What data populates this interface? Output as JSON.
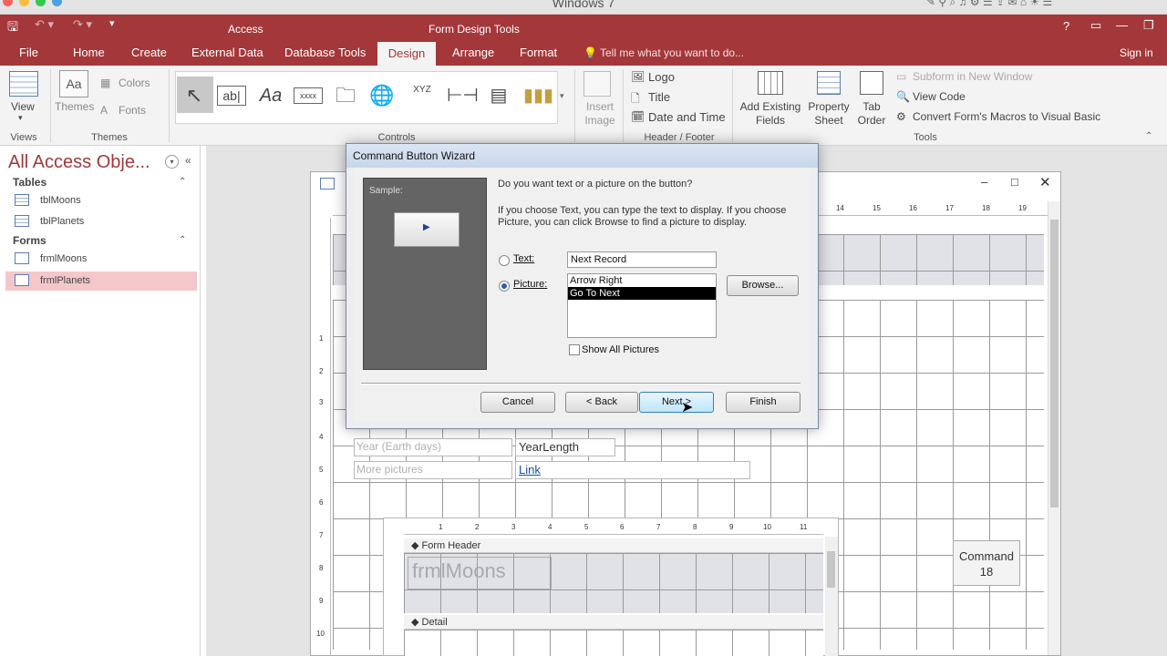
{
  "os_title": "Windows 7",
  "app": {
    "name": "Access",
    "context_tab_group": "Form Design Tools",
    "tabs": [
      "File",
      "Home",
      "Create",
      "External Data",
      "Database Tools",
      "Design",
      "Arrange",
      "Format"
    ],
    "tell_me": "Tell me what you want to do...",
    "sign_in": "Sign in",
    "help": "?"
  },
  "ribbon": {
    "views": {
      "view_label": "View",
      "group": "Views"
    },
    "themes": {
      "themes_label": "Themes",
      "colors_label": "Colors",
      "fonts_label": "Fonts",
      "group": "Themes"
    },
    "controls": {
      "group": "Controls",
      "icons": [
        "select-pointer",
        "textbox",
        "label-aa",
        "button-xxxx",
        "tab-control",
        "hyperlink",
        "web-browser",
        "navigation",
        "line",
        "page-break",
        "chart"
      ]
    },
    "insert_image": "Insert Image",
    "header_footer": {
      "logo": "Logo",
      "title": "Title",
      "date_time": "Date and Time",
      "group": "Header / Footer"
    },
    "tools": {
      "add_existing_fields": "Add Existing Fields",
      "property_sheet": "Property Sheet",
      "tab_order": "Tab Order",
      "subform_new_window": "Subform in New Window",
      "view_code": "View Code",
      "convert_macros": "Convert Form's Macros to Visual Basic",
      "group": "Tools"
    }
  },
  "nav": {
    "title": "All Access Obje...",
    "sections": [
      {
        "label": "Tables",
        "items": [
          "tblMoons",
          "tblPlanets"
        ]
      },
      {
        "label": "Forms",
        "items": [
          "frmlMoons",
          "frmlPlanets"
        ]
      }
    ],
    "selected": "frmlPlanets"
  },
  "form": {
    "ruler_numbers_top": [
      "14",
      "15",
      "16",
      "17",
      "18",
      "19"
    ],
    "ruler_numbers_left": [
      "1",
      "2",
      "3",
      "4",
      "5",
      "6",
      "7",
      "8",
      "9",
      "10"
    ],
    "fields": [
      {
        "label": "Year (Earth days)",
        "control": "YearLength"
      },
      {
        "label": "More pictures",
        "control": "Link"
      }
    ],
    "command_button": "Command 18"
  },
  "subform": {
    "ruler_numbers": [
      "1",
      "2",
      "3",
      "4",
      "5",
      "6",
      "7",
      "8",
      "9",
      "10",
      "11"
    ],
    "header_section": "Form Header",
    "title": "frmlMoons",
    "detail_section": "Detail"
  },
  "dialog": {
    "title": "Command Button Wizard",
    "sample_label": "Sample:",
    "question": "Do you want text or a picture on the button?",
    "explanation": "If you choose Text, you can type the text to display.  If you choose Picture, you can click Browse to find a picture to display.",
    "text_option": "Text:",
    "text_value": "Next Record",
    "picture_option": "Picture:",
    "selected_option": "picture",
    "picture_list": [
      "Arrow Right",
      "Go To Next"
    ],
    "selected_picture": "Go To Next",
    "browse": "Browse...",
    "show_all_pictures": "Show All Pictures",
    "show_all_checked": false,
    "buttons": {
      "cancel": "Cancel",
      "back": "< Back",
      "next": "Next >",
      "finish": "Finish"
    }
  },
  "colors": {
    "accent": "#a4373a",
    "selection": "#f4c7cb",
    "sample_bg": "#646464"
  }
}
